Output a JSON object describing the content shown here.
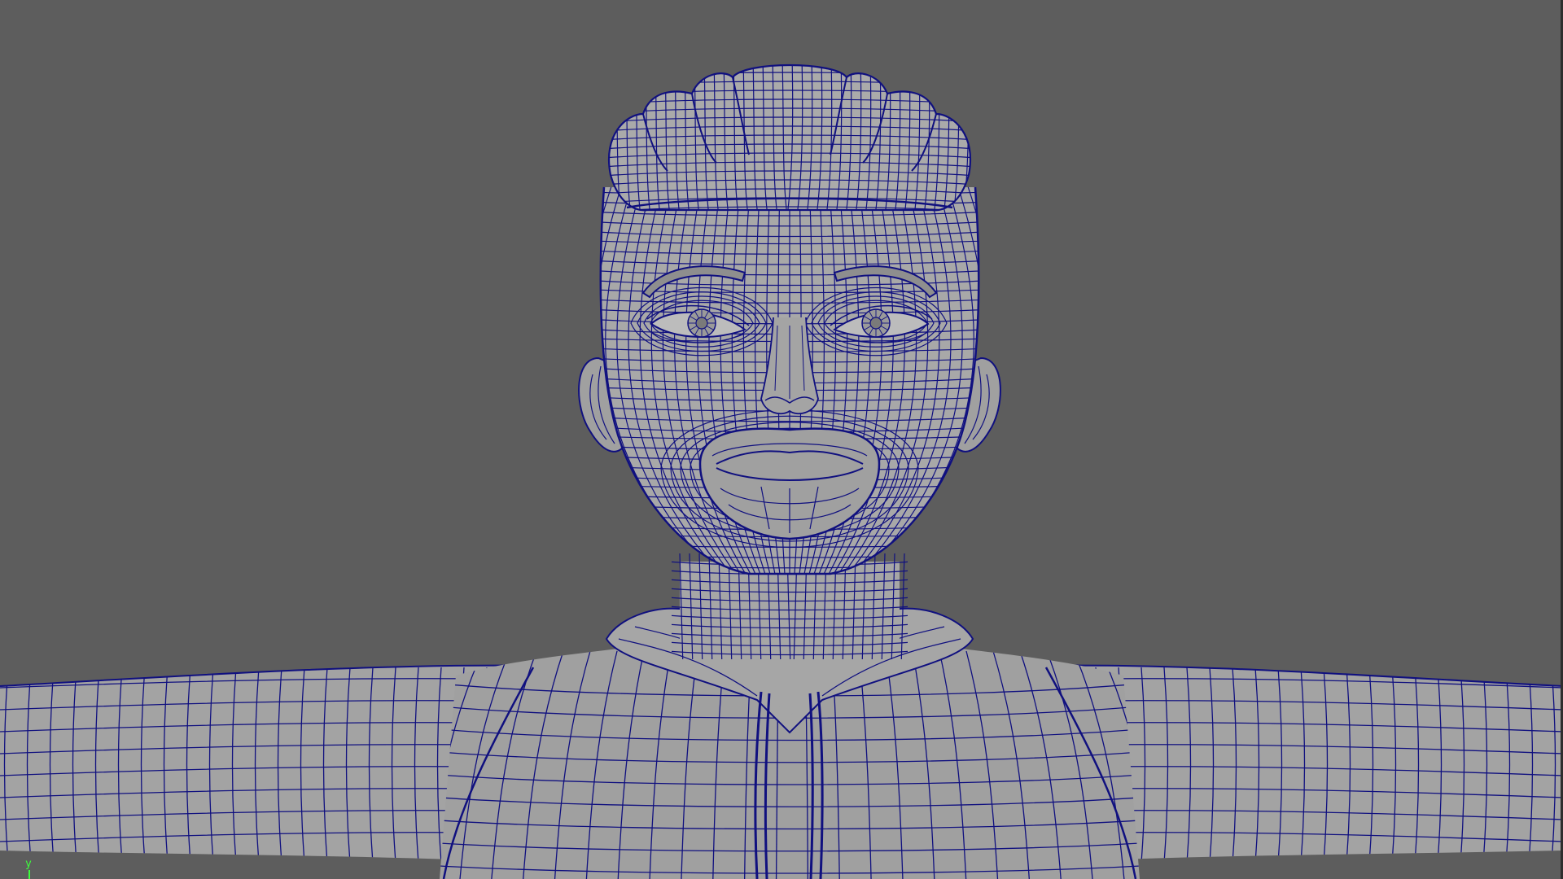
{
  "viewport": {
    "background_color": "#5d5d5d",
    "mesh_fill_color": "#a3a3a3",
    "wire_color": "#10107f",
    "view": "front",
    "display_mode": "wireframe-on-shaded"
  },
  "model": {
    "subject": "stylized-character-head-and-torso",
    "parts": [
      "hair",
      "head",
      "ears",
      "eyebrows",
      "eyes",
      "nose",
      "mouth",
      "neck",
      "hood",
      "torso",
      "arms",
      "drawstrings"
    ]
  },
  "axis_indicator": {
    "y_label": "y",
    "color": "#3cff3c"
  }
}
